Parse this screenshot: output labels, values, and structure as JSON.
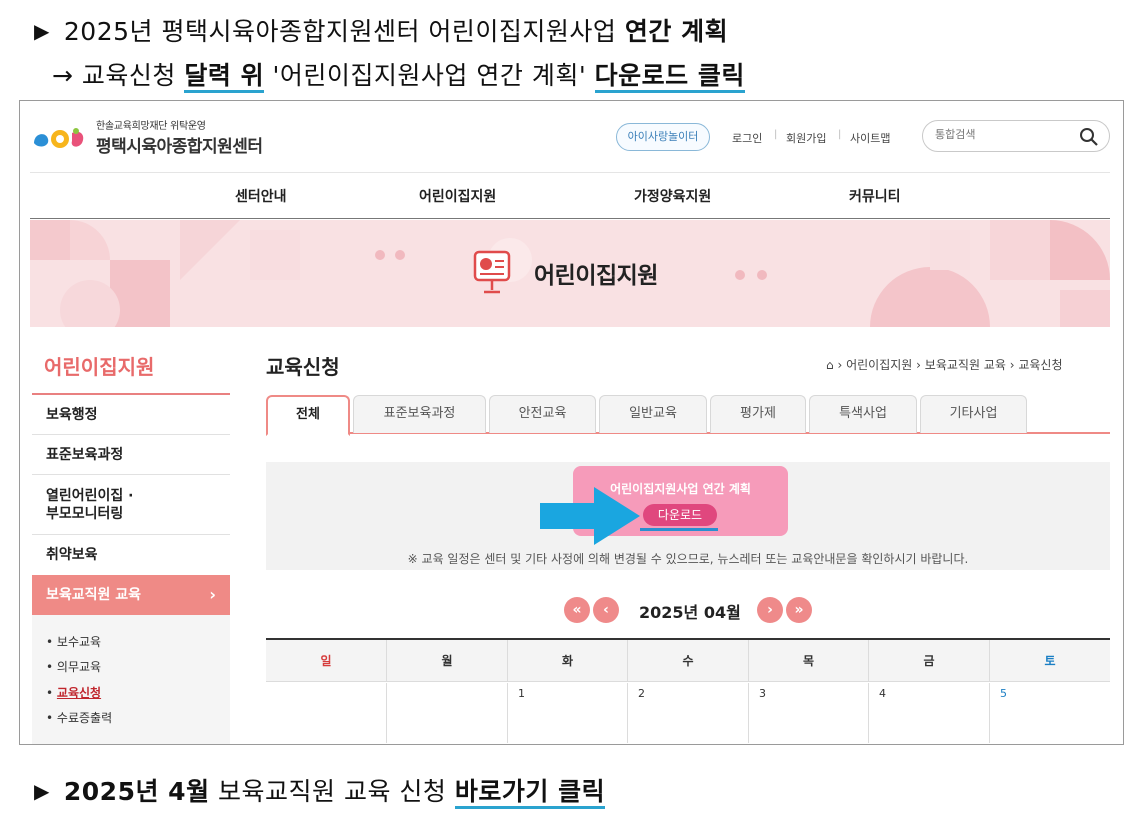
{
  "instructions": {
    "line1_prefix": "2025년 평택시육아종합지원센터 어린이집지원사업",
    "line1_bold": "연간 계획",
    "line2_arrow": "→",
    "line2_a": "교육신청",
    "line2_hl1": "달력 위",
    "line2_b": "'어린이집지원사업 연간 계획'",
    "line2_hl2": "다운로드 클릭",
    "line3_bold": "2025년 4월",
    "line3_mid": "보육교직원 교육 신청",
    "line3_hl": "바로가기 클릭"
  },
  "header": {
    "org_sub": "한솔교육희망재단 위탁운영",
    "org_name": "평택시육아종합지원센터",
    "kids_button": "아이사랑놀이터",
    "login": "로그인",
    "signup": "회원가입",
    "sitemap": "사이트맵",
    "search_placeholder": "통합검색"
  },
  "nav": [
    "센터안내",
    "어린이집지원",
    "가정양육지원",
    "커뮤니티"
  ],
  "banner": {
    "title": "어린이집지원"
  },
  "sidebar": {
    "title": "어린이집지원",
    "items": [
      "보육행정",
      "표준보육과정",
      "열린어린이집 ·",
      "부모모니터링",
      "취약보육"
    ],
    "active": "보육교직원 교육",
    "sub": [
      "보수교육",
      "의무교육",
      "교육신청",
      "수료증출력"
    ]
  },
  "main": {
    "title": "교육신청",
    "breadcrumb": [
      "어린이집지원",
      "보육교직원 교육",
      "교육신청"
    ],
    "tabs": [
      "전체",
      "표준보육과정",
      "안전교육",
      "일반교육",
      "평가제",
      "특색사업",
      "기타사업"
    ],
    "download_card_title": "어린이집지원사업 연간 계획",
    "download_button": "다운로드",
    "notice": "※ 교육 일정은 센터 및 기타 사정에 의해 변경될 수 있으므로, 뉴스레터 또는 교육안내문을 확인하시기 바랍니다.",
    "month": "2025년 04월",
    "weekdays": [
      "일",
      "월",
      "화",
      "수",
      "목",
      "금",
      "토"
    ],
    "first_week": [
      "",
      "",
      "1",
      "2",
      "3",
      "4",
      "5"
    ]
  },
  "colors": {
    "accent": "#ef8a86",
    "highlight_line": "#2aa3cf",
    "download_card": "#f69bba",
    "arrow": "#1aa6e0"
  }
}
